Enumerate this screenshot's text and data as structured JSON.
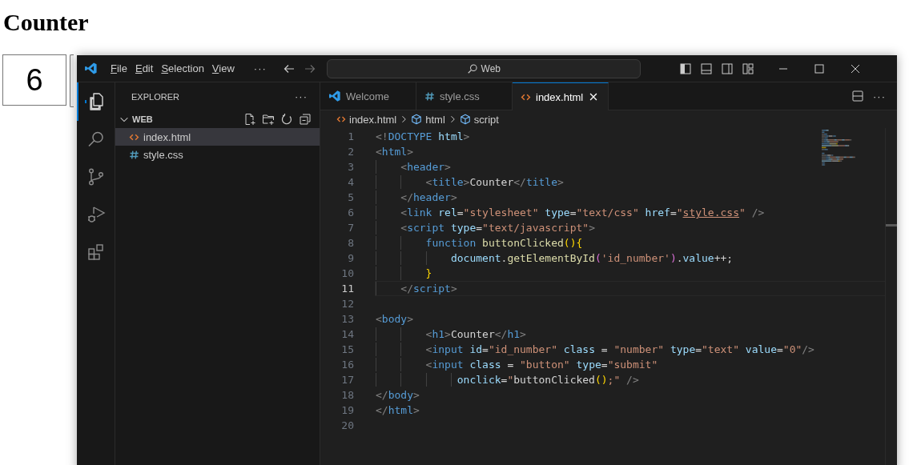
{
  "page": {
    "heading": "Counter",
    "number_field": {
      "value": "6"
    }
  },
  "editor_window": {
    "menu": [
      "File",
      "Edit",
      "Selection",
      "View"
    ],
    "more_menu": "···",
    "search": {
      "value": "Web"
    },
    "explorer": {
      "title": "EXPLORER",
      "more": "···",
      "folder": {
        "name": "WEB",
        "expanded": true,
        "files": [
          {
            "name": "index.html",
            "kind": "html",
            "selected": true
          },
          {
            "name": "style.css",
            "kind": "css",
            "selected": false
          }
        ]
      }
    },
    "tabs": [
      {
        "label": "Welcome",
        "kind": "vscode",
        "selected": false
      },
      {
        "label": "style.css",
        "kind": "css",
        "selected": false
      },
      {
        "label": "index.html",
        "kind": "html",
        "selected": true
      }
    ],
    "tabs_more": "···",
    "breadcrumbs": [
      {
        "label": "index.html",
        "kind": "html"
      },
      {
        "label": "html",
        "kind": "element"
      },
      {
        "label": "script",
        "kind": "element"
      }
    ],
    "code_lines": [
      {
        "number": "1",
        "current": false,
        "tokens": [
          {
            "kind": "punct",
            "text": "<!"
          },
          {
            "kind": "keyword",
            "text": "DOCTYPE"
          },
          {
            "kind": "attr",
            "text": " html"
          },
          {
            "kind": "punct",
            "text": ">"
          }
        ]
      },
      {
        "number": "2",
        "current": false,
        "tokens": [
          {
            "kind": "punct",
            "text": "<"
          },
          {
            "kind": "tag",
            "text": "html"
          },
          {
            "kind": "punct",
            "text": ">"
          }
        ]
      },
      {
        "number": "3",
        "current": false,
        "tokens": [
          {
            "kind": "punct",
            "text": "    <"
          },
          {
            "kind": "tag",
            "text": "header"
          },
          {
            "kind": "punct",
            "text": ">"
          }
        ]
      },
      {
        "number": "4",
        "current": false,
        "tokens": [
          {
            "kind": "punct",
            "text": "        <"
          },
          {
            "kind": "tag",
            "text": "title"
          },
          {
            "kind": "punct",
            "text": ">"
          },
          {
            "kind": "text",
            "text": "Counter"
          },
          {
            "kind": "punct",
            "text": "</"
          },
          {
            "kind": "tag",
            "text": "title"
          },
          {
            "kind": "punct",
            "text": ">"
          }
        ]
      },
      {
        "number": "5",
        "current": false,
        "tokens": [
          {
            "kind": "punct",
            "text": "    </"
          },
          {
            "kind": "tag",
            "text": "header"
          },
          {
            "kind": "punct",
            "text": ">"
          }
        ]
      },
      {
        "number": "6",
        "current": false,
        "tokens": [
          {
            "kind": "punct",
            "text": "    <"
          },
          {
            "kind": "tag",
            "text": "link"
          },
          {
            "kind": "attr",
            "text": " rel"
          },
          {
            "kind": "text",
            "text": "="
          },
          {
            "kind": "string",
            "text": "\"stylesheet\""
          },
          {
            "kind": "attr",
            "text": " type"
          },
          {
            "kind": "text",
            "text": "="
          },
          {
            "kind": "string",
            "text": "\"text/css\""
          },
          {
            "kind": "attr",
            "text": " href"
          },
          {
            "kind": "text",
            "text": "="
          },
          {
            "kind": "string",
            "text": "\""
          },
          {
            "kind": "link",
            "text": "style.css"
          },
          {
            "kind": "string",
            "text": "\""
          },
          {
            "kind": "punct",
            "text": " />"
          }
        ]
      },
      {
        "number": "7",
        "current": false,
        "tokens": [
          {
            "kind": "punct",
            "text": "    <"
          },
          {
            "kind": "tag",
            "text": "script"
          },
          {
            "kind": "attr",
            "text": " type"
          },
          {
            "kind": "text",
            "text": "="
          },
          {
            "kind": "string",
            "text": "\"text/javascript\""
          },
          {
            "kind": "punct",
            "text": ">"
          }
        ]
      },
      {
        "number": "8",
        "current": false,
        "tokens": [
          {
            "kind": "keyword",
            "text": "        function"
          },
          {
            "kind": "function",
            "text": " buttonClicked"
          },
          {
            "kind": "bracket",
            "text": "(){"
          }
        ]
      },
      {
        "number": "9",
        "current": false,
        "tokens": [
          {
            "kind": "attr",
            "text": "            document"
          },
          {
            "kind": "text",
            "text": "."
          },
          {
            "kind": "function",
            "text": "getElementById"
          },
          {
            "kind": "bracket2",
            "text": "("
          },
          {
            "kind": "string",
            "text": "'id_number'"
          },
          {
            "kind": "bracket2",
            "text": ")"
          },
          {
            "kind": "text",
            "text": "."
          },
          {
            "kind": "attr",
            "text": "value"
          },
          {
            "kind": "text",
            "text": "++;"
          }
        ]
      },
      {
        "number": "10",
        "current": false,
        "tokens": [
          {
            "kind": "bracket",
            "text": "        }"
          }
        ]
      },
      {
        "number": "11",
        "current": true,
        "tokens": [
          {
            "kind": "punct",
            "text": "    </"
          },
          {
            "kind": "tag",
            "text": "script"
          },
          {
            "kind": "punct",
            "text": ">"
          }
        ]
      },
      {
        "number": "12",
        "current": false
      },
      {
        "number": "13",
        "current": false,
        "tokens": [
          {
            "kind": "punct",
            "text": "<"
          },
          {
            "kind": "tag",
            "text": "body"
          },
          {
            "kind": "punct",
            "text": ">"
          }
        ]
      },
      {
        "number": "14",
        "current": false,
        "tokens": [
          {
            "kind": "punct",
            "text": "        <"
          },
          {
            "kind": "tag",
            "text": "h1"
          },
          {
            "kind": "punct",
            "text": ">"
          },
          {
            "kind": "text",
            "text": "Counter"
          },
          {
            "kind": "punct",
            "text": "</"
          },
          {
            "kind": "tag",
            "text": "h1"
          },
          {
            "kind": "punct",
            "text": ">"
          }
        ]
      },
      {
        "number": "15",
        "current": false,
        "tokens": [
          {
            "kind": "punct",
            "text": "        <"
          },
          {
            "kind": "tag",
            "text": "input"
          },
          {
            "kind": "attr",
            "text": " id"
          },
          {
            "kind": "text",
            "text": "="
          },
          {
            "kind": "string",
            "text": "\"id_number\""
          },
          {
            "kind": "attr",
            "text": " class"
          },
          {
            "kind": "text",
            "text": " = "
          },
          {
            "kind": "string",
            "text": "\"number\""
          },
          {
            "kind": "attr",
            "text": " type"
          },
          {
            "kind": "text",
            "text": "="
          },
          {
            "kind": "string",
            "text": "\"text\""
          },
          {
            "kind": "attr",
            "text": " value"
          },
          {
            "kind": "text",
            "text": "="
          },
          {
            "kind": "string",
            "text": "\"0\""
          },
          {
            "kind": "punct",
            "text": "/>"
          }
        ]
      },
      {
        "number": "16",
        "current": false,
        "tokens": [
          {
            "kind": "punct",
            "text": "        <"
          },
          {
            "kind": "tag",
            "text": "input"
          },
          {
            "kind": "attr",
            "text": " class"
          },
          {
            "kind": "text",
            "text": " = "
          },
          {
            "kind": "string",
            "text": "\"button\""
          },
          {
            "kind": "attr",
            "text": " type"
          },
          {
            "kind": "text",
            "text": "="
          },
          {
            "kind": "string",
            "text": "\"submit\""
          }
        ]
      },
      {
        "number": "17",
        "current": false,
        "tokens": [
          {
            "kind": "attr",
            "text": "             onclick"
          },
          {
            "kind": "text",
            "text": "="
          },
          {
            "kind": "string",
            "text": "\""
          },
          {
            "kind": "text",
            "text": "buttonClicked"
          },
          {
            "kind": "bracket",
            "text": "()"
          },
          {
            "kind": "string",
            "text": ";\""
          },
          {
            "kind": "punct",
            "text": " />"
          }
        ]
      },
      {
        "number": "18",
        "current": false,
        "tokens": [
          {
            "kind": "punct",
            "text": "</"
          },
          {
            "kind": "tag",
            "text": "body"
          },
          {
            "kind": "punct",
            "text": ">"
          }
        ]
      },
      {
        "number": "19",
        "current": false,
        "tokens": [
          {
            "kind": "punct",
            "text": "</"
          },
          {
            "kind": "tag",
            "text": "html"
          },
          {
            "kind": "punct",
            "text": ">"
          }
        ]
      },
      {
        "number": "20",
        "current": false
      }
    ]
  }
}
